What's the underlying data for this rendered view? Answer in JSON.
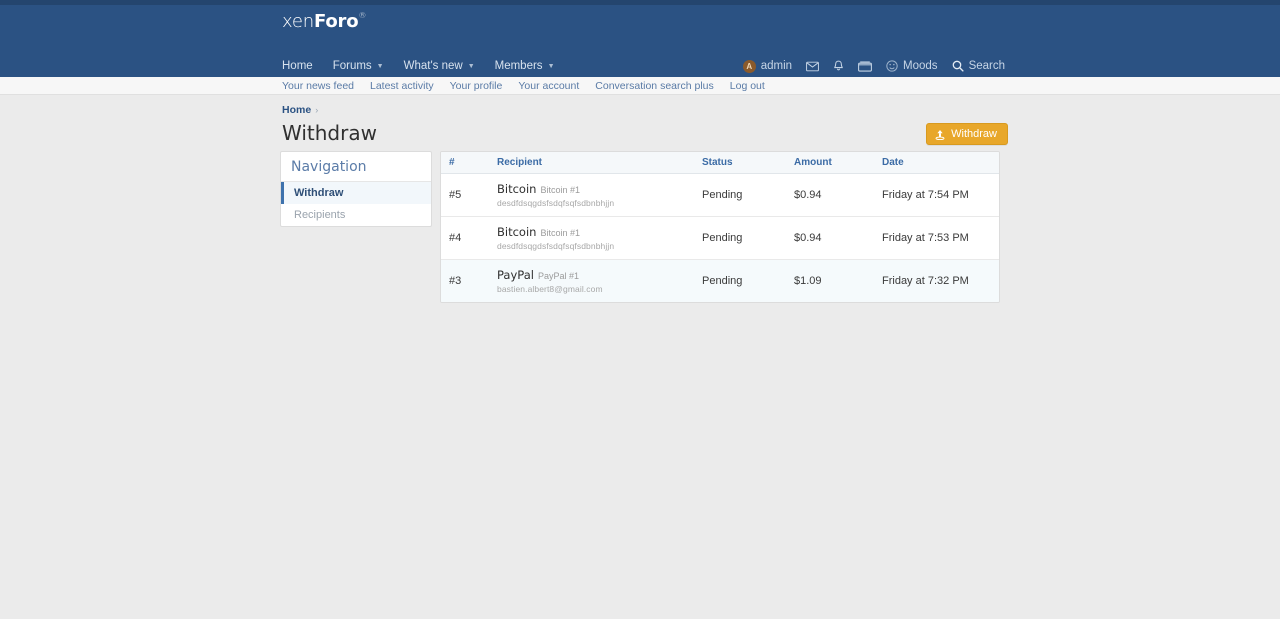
{
  "site": {
    "logo_text_1": "xen",
    "logo_text_2": "Foro",
    "logo_tm": "®"
  },
  "nav_main": {
    "items": [
      {
        "label": "Home",
        "has_caret": false
      },
      {
        "label": "Forums",
        "has_caret": true
      },
      {
        "label": "What's new",
        "has_caret": true
      },
      {
        "label": "Members",
        "has_caret": true
      }
    ],
    "right": {
      "user": "admin",
      "user_initial": "A",
      "inbox_icon": "envelope-icon",
      "alerts_icon": "bell-icon",
      "conversations_icon": "mail-stack-icon",
      "moods_label": "Moods",
      "moods_icon": "smiley-icon",
      "search_label": "Search",
      "search_icon": "search-icon"
    }
  },
  "nav_sub": {
    "items": [
      "Your news feed",
      "Latest activity",
      "Your profile",
      "Your account",
      "Conversation search plus",
      "Log out"
    ]
  },
  "breadcrumb": {
    "home": "Home",
    "separator": "›"
  },
  "page": {
    "title": "Withdraw",
    "action_button": {
      "label": "Withdraw",
      "icon": "coin-icon",
      "color": "#e8a72a"
    }
  },
  "sidebar": {
    "header": "Navigation",
    "items": [
      {
        "label": "Withdraw",
        "active": true
      },
      {
        "label": "Recipients",
        "active": false
      }
    ]
  },
  "table": {
    "columns": [
      "#",
      "Recipient",
      "Status",
      "Amount",
      "Date"
    ],
    "rows": [
      {
        "num": "#5",
        "recipient_type": "Bitcoin",
        "recipient_label": "Bitcoin #1",
        "recipient_detail": "desdfdsqgdsfsdqfsqfsdbnbhjjn",
        "status": "Pending",
        "amount": "$0.94",
        "date": "Friday at 7:54 PM",
        "tinted": false
      },
      {
        "num": "#4",
        "recipient_type": "Bitcoin",
        "recipient_label": "Bitcoin #1",
        "recipient_detail": "desdfdsqgdsfsdqfsqfsdbnbhjjn",
        "status": "Pending",
        "amount": "$0.94",
        "date": "Friday at 7:53 PM",
        "tinted": false
      },
      {
        "num": "#3",
        "recipient_type": "PayPal",
        "recipient_label": "PayPal #1",
        "recipient_detail": "bastien.albert8@gmail.com",
        "status": "Pending",
        "amount": "$1.09",
        "date": "Friday at 7:32 PM",
        "tinted": true
      }
    ]
  },
  "theme": {
    "header_bg": "#2b5283",
    "top_strip": "#24456e",
    "accent": "#e8a72a",
    "link": "#3b6ba5",
    "page_bg": "#ebebeb"
  }
}
